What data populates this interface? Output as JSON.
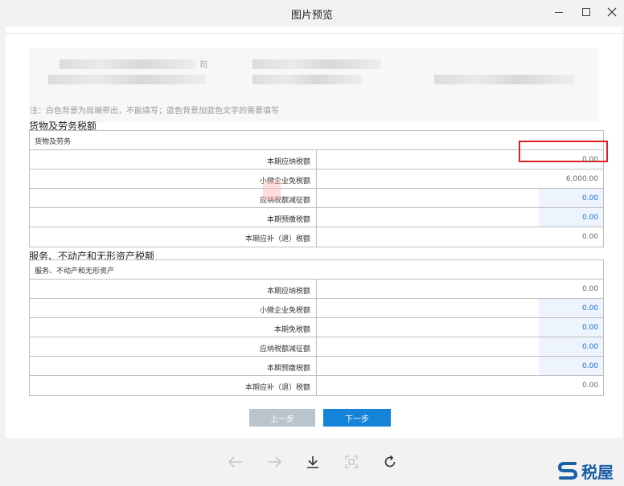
{
  "window": {
    "title": "图片预览"
  },
  "note": "注：白色背景为局端带出，不能填写；蓝色背景加蓝色文字的需要填写",
  "header_info": {
    "company_fragment": "司"
  },
  "goods_section": {
    "title": "货物及劳务税额",
    "subtitle": "货物及劳务",
    "rows": [
      {
        "label": "本期应纳税额",
        "value": "0.00",
        "editable": false
      },
      {
        "label": "小微企业免税额",
        "value": "6,000.00",
        "editable": false
      },
      {
        "label": "应纳税额减征额",
        "value": "0.00",
        "editable": true
      },
      {
        "label": "本期预缴税额",
        "value": "0.00",
        "editable": true
      },
      {
        "label": "本期应补（退）税额",
        "value": "0.00",
        "editable": false
      }
    ]
  },
  "services_section": {
    "title": "服务、不动产和无形资产税额",
    "subtitle": "服务、不动产和无形资产",
    "rows": [
      {
        "label": "本期应纳税额",
        "value": "0.00",
        "editable": false
      },
      {
        "label": "小微企业免税额",
        "value": "0.00",
        "editable": true
      },
      {
        "label": "本期免税额",
        "value": "0.00",
        "editable": true
      },
      {
        "label": "应纳税额减征额",
        "value": "0.00",
        "editable": true
      },
      {
        "label": "本期预缴税额",
        "value": "0.00",
        "editable": true
      },
      {
        "label": "本期应补（退）税额",
        "value": "0.00",
        "editable": false
      }
    ]
  },
  "buttons": {
    "prev": "上一步",
    "next": "下一步"
  },
  "viewer_toolbar": [
    "arrow-left-icon",
    "arrow-right-icon",
    "download-icon",
    "fit-screen-icon",
    "rotate-icon"
  ],
  "logo": {
    "name": "税屋"
  },
  "colors": {
    "highlight": "#e02020",
    "primary": "#1583d8",
    "editable_bg": "#eef4fd",
    "editable_text": "#1a6fd1"
  }
}
